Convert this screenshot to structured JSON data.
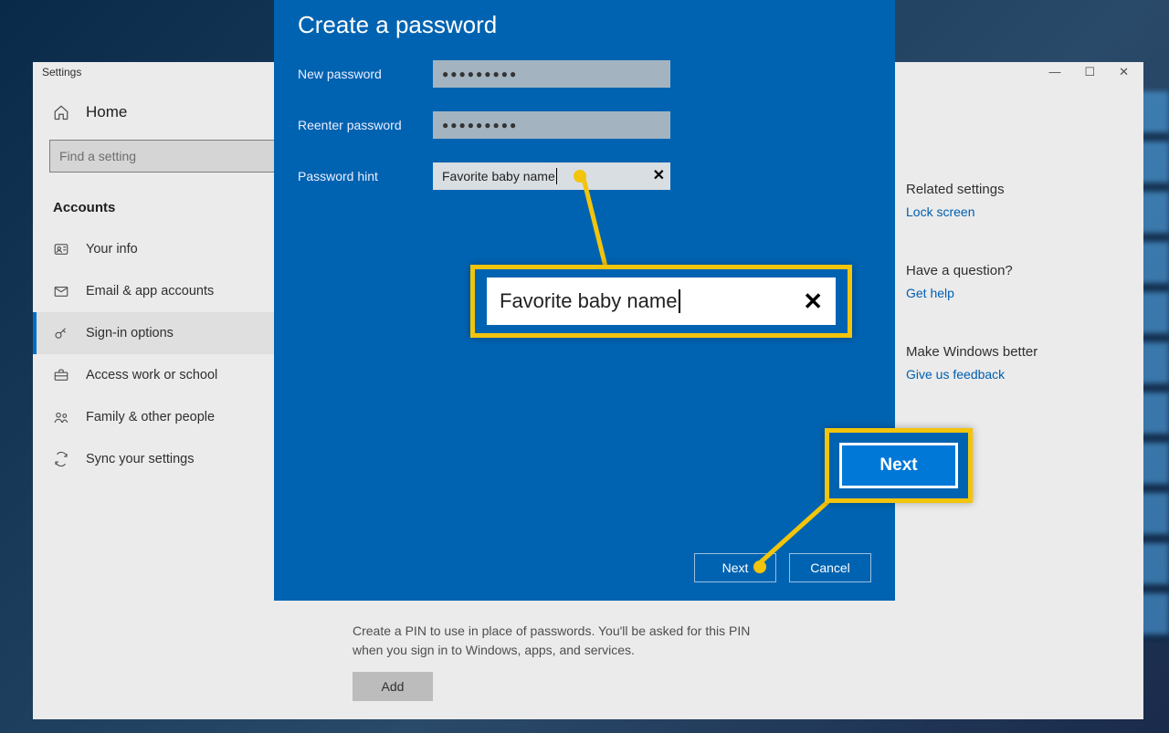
{
  "window": {
    "title": "Settings",
    "home": "Home",
    "search_placeholder": "Find a setting",
    "section": "Accounts",
    "nav": [
      {
        "label": "Your info"
      },
      {
        "label": "Email & app accounts"
      },
      {
        "label": "Sign-in options"
      },
      {
        "label": "Access work or school"
      },
      {
        "label": "Family & other people"
      },
      {
        "label": "Sync your settings"
      }
    ],
    "pin_desc": "Create a PIN to use in place of passwords. You'll be asked for this PIN when you sign in to Windows, apps, and services.",
    "add": "Add"
  },
  "side": {
    "related_h": "Related settings",
    "related_link": "Lock screen",
    "question_h": "Have a question?",
    "question_link": "Get help",
    "better_h": "Make Windows better",
    "better_link": "Give us feedback"
  },
  "modal": {
    "title": "Create a password",
    "new_password_label": "New password",
    "reenter_label": "Reenter password",
    "hint_label": "Password hint",
    "hint_value": "Favorite baby name",
    "password_mask": "●●●●●●●●●",
    "next": "Next",
    "cancel": "Cancel"
  },
  "callout": {
    "hint_text": "Favorite baby name",
    "next_text": "Next"
  }
}
